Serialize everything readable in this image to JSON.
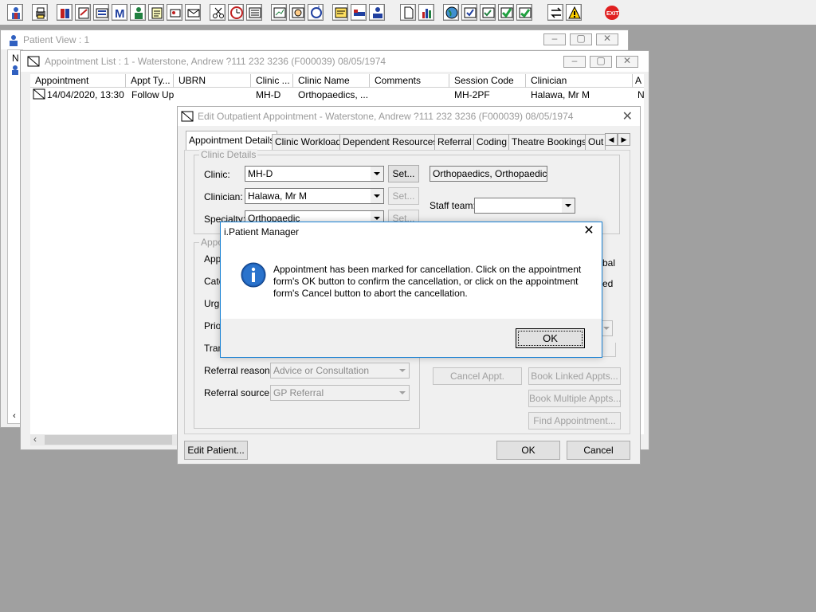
{
  "toolbar": {
    "icons": [
      "patient-icon",
      "print-icon",
      "books-icon",
      "notes-icon",
      "directory-icon",
      "m-icon",
      "clinician-icon",
      "forms-icon",
      "referral-icon",
      "mail-icon",
      "scissors-icon",
      "clock-icon",
      "list-icon",
      "chart-icon",
      "gauge-icon",
      "refresh-icon",
      "message-icon",
      "bed-icon",
      "team-icon",
      "document-icon",
      "bar-chart-icon",
      "globe-icon",
      "check-icon",
      "checklist-icon",
      "green-check-icon",
      "green-list-icon",
      "swap-icon",
      "warning-icon",
      "exit-icon"
    ],
    "exit_label": "EXIT"
  },
  "patient_view": {
    "title": "Patient View : 1",
    "col_label": "N"
  },
  "appointment_list": {
    "title": "Appointment List : 1 - Waterstone, Andrew ?111 232 3236 (F000039) 08/05/1974",
    "columns": [
      "Appointment",
      "Appt Ty...",
      "UBRN",
      "Clinic ...",
      "Clinic Name",
      "Comments",
      "Session Code",
      "Clinician",
      "A"
    ],
    "rows": [
      {
        "appointment": "14/04/2020, 13:30",
        "type": "Follow Up",
        "ubrn": "",
        "clinic": "MH-D",
        "clinic_name": "Orthopaedics, ...",
        "comments": "",
        "session": "MH-2PF",
        "clinician": "Halawa, Mr M",
        "a": "N"
      }
    ]
  },
  "edit_dialog": {
    "title": "Edit Outpatient Appointment - Waterstone, Andrew ?111 232 3236 (F000039) 08/05/1974",
    "tabs": [
      "Appointment Details",
      "Clinic Workload",
      "Dependent Resources",
      "Referral",
      "Coding",
      "Theatre Bookings",
      "Out"
    ],
    "clinic_details_label": "Clinic Details",
    "clinic_label": "Clinic:",
    "clinic_value": "MH-D",
    "clinic_name_value": "Orthopaedics, Orthopaedic OF",
    "clinician_label": "Clinician:",
    "clinician_value": "Halawa, Mr M",
    "specialty_label": "Specialty:",
    "specialty_value": "Orthopaedic",
    "set_label": "Set...",
    "staff_team_label": "Staff team:",
    "staff_team_value": "",
    "appt_group_label": "Appo",
    "appt_row_labels": [
      "Appt",
      "Cate",
      "Urge",
      "Prior",
      "Tran"
    ],
    "right_partial_1": "bal",
    "right_partial_2": "ed",
    "referral_reason_label": "Referral reason:",
    "referral_reason_value": "Advice or Consultation",
    "referral_source_label": "Referral source:",
    "referral_source_value": "GP Referral",
    "cancel_appt_label": "Cancel Appt.",
    "book_linked_label": "Book Linked Appts...",
    "book_multiple_label": "Book Multiple Appts...",
    "find_appointment_label": "Find Appointment...",
    "edit_patient_label": "Edit Patient...",
    "ok_label": "OK",
    "cancel_label": "Cancel"
  },
  "message_box": {
    "title": "i.Patient Manager",
    "text": "Appointment has been marked for cancellation. Click on the appointment form's OK button to confirm the cancellation, or click on the appointment form's Cancel button to abort the cancellation.",
    "ok_label": "OK"
  },
  "colors": {
    "accent": "#1a82d4",
    "info_icon": "#1f5fb4",
    "exit_red": "#e02020"
  }
}
